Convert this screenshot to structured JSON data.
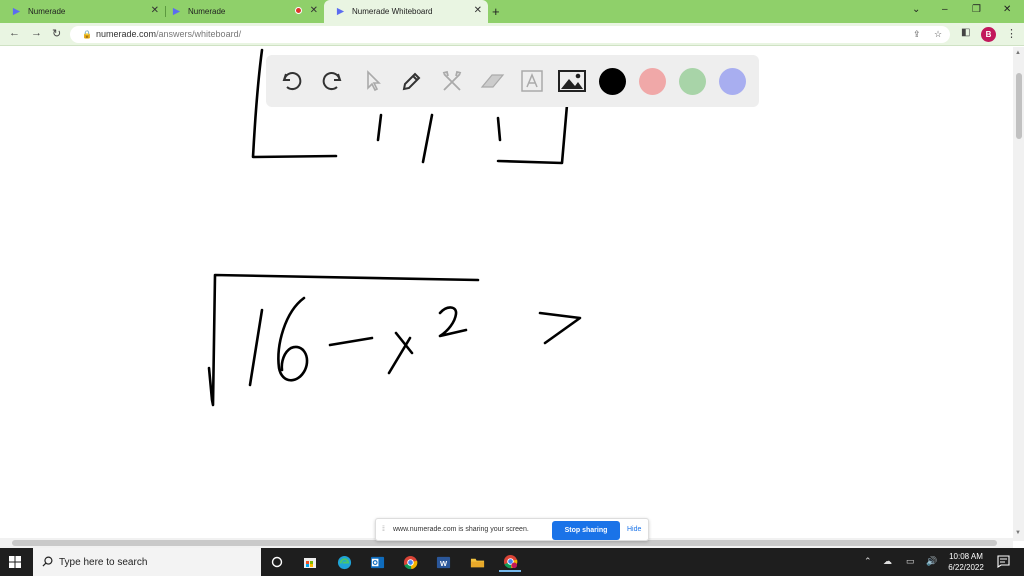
{
  "browser": {
    "tabs": [
      {
        "title": "Numerade",
        "active": false
      },
      {
        "title": "Numerade",
        "active": false
      },
      {
        "title": "Numerade Whiteboard",
        "active": true
      }
    ],
    "new_tab": "+",
    "window_controls": {
      "minimize": "⌄",
      "restore": "–",
      "maximize": "❐",
      "close": "✕"
    },
    "nav": {
      "back": "←",
      "forward": "→",
      "reload": "↻"
    },
    "address": {
      "domain": "numerade.com",
      "path": "/answers/whiteboard/"
    },
    "profile_initial": "B"
  },
  "whiteboard": {
    "tools": [
      {
        "name": "undo",
        "enabled": true
      },
      {
        "name": "redo",
        "enabled": true
      },
      {
        "name": "select",
        "enabled": false
      },
      {
        "name": "pen",
        "enabled": true
      },
      {
        "name": "tools",
        "enabled": false
      },
      {
        "name": "eraser",
        "enabled": false
      },
      {
        "name": "text",
        "enabled": false
      },
      {
        "name": "image",
        "enabled": true
      }
    ],
    "colors": [
      "#000000",
      "#f0a8a8",
      "#a8d4a8",
      "#a8aef0"
    ],
    "selected_color": "#000000"
  },
  "share_banner": {
    "message": "www.numerade.com is sharing your screen.",
    "stop_label": "Stop sharing",
    "hide_label": "Hide"
  },
  "taskbar": {
    "search_placeholder": "Type here to search",
    "time": "10:08 AM",
    "date": "6/22/2022"
  }
}
